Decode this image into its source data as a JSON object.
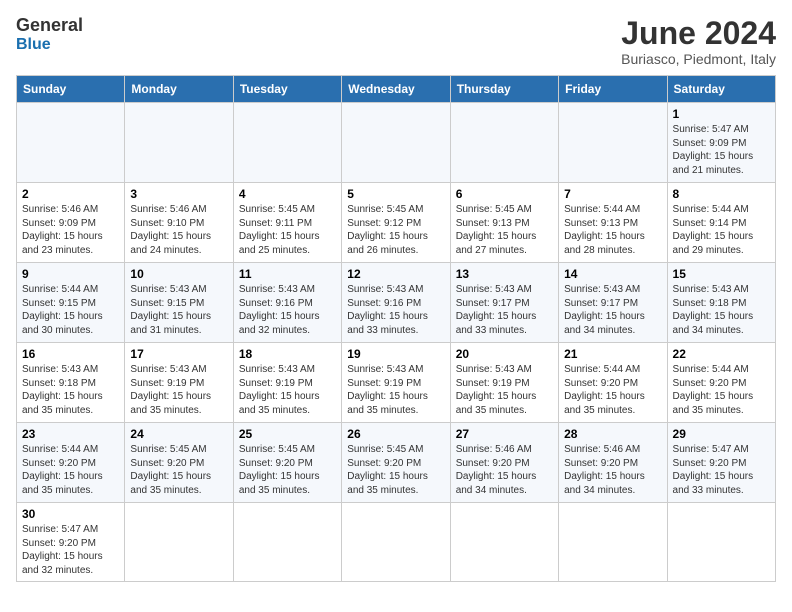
{
  "header": {
    "logo_general": "General",
    "logo_blue": "Blue",
    "title": "June 2024",
    "subtitle": "Buriasco, Piedmont, Italy"
  },
  "weekdays": [
    "Sunday",
    "Monday",
    "Tuesday",
    "Wednesday",
    "Thursday",
    "Friday",
    "Saturday"
  ],
  "weeks": [
    [
      {
        "day": "",
        "info": ""
      },
      {
        "day": "",
        "info": ""
      },
      {
        "day": "",
        "info": ""
      },
      {
        "day": "",
        "info": ""
      },
      {
        "day": "",
        "info": ""
      },
      {
        "day": "",
        "info": ""
      },
      {
        "day": "1",
        "info": "Sunrise: 5:47 AM\nSunset: 9:09 PM\nDaylight: 15 hours and 21 minutes."
      }
    ],
    [
      {
        "day": "2",
        "info": "Sunrise: 5:46 AM\nSunset: 9:09 PM\nDaylight: 15 hours and 23 minutes."
      },
      {
        "day": "3",
        "info": "Sunrise: 5:46 AM\nSunset: 9:10 PM\nDaylight: 15 hours and 24 minutes."
      },
      {
        "day": "4",
        "info": "Sunrise: 5:45 AM\nSunset: 9:11 PM\nDaylight: 15 hours and 25 minutes."
      },
      {
        "day": "5",
        "info": "Sunrise: 5:45 AM\nSunset: 9:12 PM\nDaylight: 15 hours and 26 minutes."
      },
      {
        "day": "6",
        "info": "Sunrise: 5:45 AM\nSunset: 9:13 PM\nDaylight: 15 hours and 27 minutes."
      },
      {
        "day": "7",
        "info": "Sunrise: 5:44 AM\nSunset: 9:13 PM\nDaylight: 15 hours and 28 minutes."
      },
      {
        "day": "8",
        "info": "Sunrise: 5:44 AM\nSunset: 9:14 PM\nDaylight: 15 hours and 29 minutes."
      }
    ],
    [
      {
        "day": "9",
        "info": "Sunrise: 5:44 AM\nSunset: 9:15 PM\nDaylight: 15 hours and 30 minutes."
      },
      {
        "day": "10",
        "info": "Sunrise: 5:43 AM\nSunset: 9:15 PM\nDaylight: 15 hours and 31 minutes."
      },
      {
        "day": "11",
        "info": "Sunrise: 5:43 AM\nSunset: 9:16 PM\nDaylight: 15 hours and 32 minutes."
      },
      {
        "day": "12",
        "info": "Sunrise: 5:43 AM\nSunset: 9:16 PM\nDaylight: 15 hours and 33 minutes."
      },
      {
        "day": "13",
        "info": "Sunrise: 5:43 AM\nSunset: 9:17 PM\nDaylight: 15 hours and 33 minutes."
      },
      {
        "day": "14",
        "info": "Sunrise: 5:43 AM\nSunset: 9:17 PM\nDaylight: 15 hours and 34 minutes."
      },
      {
        "day": "15",
        "info": "Sunrise: 5:43 AM\nSunset: 9:18 PM\nDaylight: 15 hours and 34 minutes."
      }
    ],
    [
      {
        "day": "16",
        "info": "Sunrise: 5:43 AM\nSunset: 9:18 PM\nDaylight: 15 hours and 35 minutes."
      },
      {
        "day": "17",
        "info": "Sunrise: 5:43 AM\nSunset: 9:19 PM\nDaylight: 15 hours and 35 minutes."
      },
      {
        "day": "18",
        "info": "Sunrise: 5:43 AM\nSunset: 9:19 PM\nDaylight: 15 hours and 35 minutes."
      },
      {
        "day": "19",
        "info": "Sunrise: 5:43 AM\nSunset: 9:19 PM\nDaylight: 15 hours and 35 minutes."
      },
      {
        "day": "20",
        "info": "Sunrise: 5:43 AM\nSunset: 9:19 PM\nDaylight: 15 hours and 35 minutes."
      },
      {
        "day": "21",
        "info": "Sunrise: 5:44 AM\nSunset: 9:20 PM\nDaylight: 15 hours and 35 minutes."
      },
      {
        "day": "22",
        "info": "Sunrise: 5:44 AM\nSunset: 9:20 PM\nDaylight: 15 hours and 35 minutes."
      }
    ],
    [
      {
        "day": "23",
        "info": "Sunrise: 5:44 AM\nSunset: 9:20 PM\nDaylight: 15 hours and 35 minutes."
      },
      {
        "day": "24",
        "info": "Sunrise: 5:45 AM\nSunset: 9:20 PM\nDaylight: 15 hours and 35 minutes."
      },
      {
        "day": "25",
        "info": "Sunrise: 5:45 AM\nSunset: 9:20 PM\nDaylight: 15 hours and 35 minutes."
      },
      {
        "day": "26",
        "info": "Sunrise: 5:45 AM\nSunset: 9:20 PM\nDaylight: 15 hours and 35 minutes."
      },
      {
        "day": "27",
        "info": "Sunrise: 5:46 AM\nSunset: 9:20 PM\nDaylight: 15 hours and 34 minutes."
      },
      {
        "day": "28",
        "info": "Sunrise: 5:46 AM\nSunset: 9:20 PM\nDaylight: 15 hours and 34 minutes."
      },
      {
        "day": "29",
        "info": "Sunrise: 5:47 AM\nSunset: 9:20 PM\nDaylight: 15 hours and 33 minutes."
      }
    ],
    [
      {
        "day": "30",
        "info": "Sunrise: 5:47 AM\nSunset: 9:20 PM\nDaylight: 15 hours and 32 minutes."
      },
      {
        "day": "",
        "info": ""
      },
      {
        "day": "",
        "info": ""
      },
      {
        "day": "",
        "info": ""
      },
      {
        "day": "",
        "info": ""
      },
      {
        "day": "",
        "info": ""
      },
      {
        "day": "",
        "info": ""
      }
    ]
  ]
}
